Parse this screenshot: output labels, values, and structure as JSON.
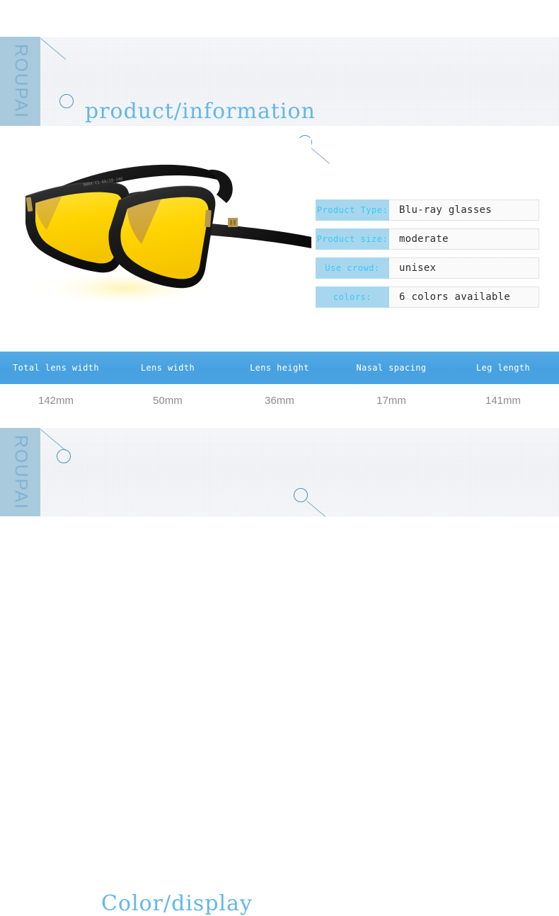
{
  "brand": {
    "name": "ROUPAI"
  },
  "banners": {
    "top": {
      "title": "product/information"
    },
    "bottom": {
      "title": "Color/display"
    }
  },
  "product_photo": {
    "alt": "black-frame-glasses-yellow-lenses",
    "frame_color": "#1c1c1c",
    "lens_color": "#ffd900"
  },
  "spec_table": {
    "rows": [
      {
        "label": "Product Type:",
        "value": "Blu-ray glasses"
      },
      {
        "label": "Product size:",
        "value": "moderate"
      },
      {
        "label": "Use crowd:",
        "value": "unisex"
      },
      {
        "label": "colors:",
        "value": "6 colors available"
      }
    ]
  },
  "dimension_table": {
    "headers": [
      "Total lens width",
      "Lens width",
      "Lens height",
      "Nasal spacing",
      "Leg length"
    ],
    "values": [
      "142mm",
      "50mm",
      "36mm",
      "17mm",
      "141mm"
    ]
  },
  "colors": {
    "banner_tab": "#a9c9dd",
    "banner_title": "#63b8e8",
    "spec_label_bg": "#a6d7ef",
    "spec_label_text": "#3ec6f0",
    "dim_header_bg": "#4aa4e2",
    "dim_value_text": "#8d8d8f",
    "deco_stroke": "#4d94b8"
  }
}
